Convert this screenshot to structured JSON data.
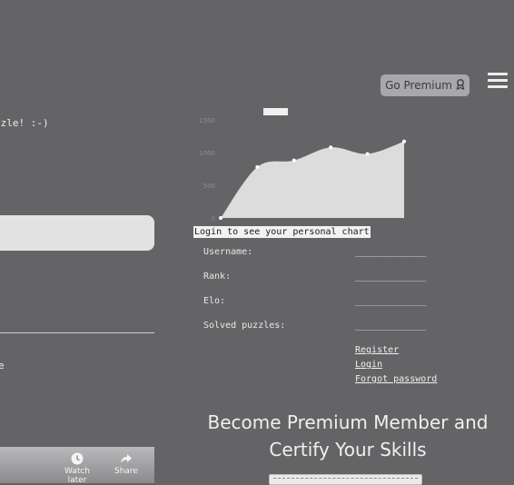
{
  "header": {
    "go_premium_label": "Go Premium"
  },
  "puzzle": {
    "message_fragment": "zzle! :-)",
    "side_fragment": "e"
  },
  "video": {
    "watch_later_label": "Watch later",
    "share_label": "Share"
  },
  "chart": {
    "login_banner": "Login to see your personal chart"
  },
  "chart_data": {
    "type": "area",
    "title": "",
    "xlabel": "",
    "ylabel": "",
    "y_ticks": [
      "1500",
      "1000",
      "500",
      "0"
    ],
    "ylim": [
      0,
      1500
    ],
    "x": [
      1,
      2,
      3,
      4,
      5,
      6
    ],
    "values": [
      0,
      780,
      880,
      1080,
      980,
      1170
    ],
    "grid": false,
    "colors": {
      "fill": "#dcdcdc",
      "points": "#ffffff"
    }
  },
  "stats": [
    {
      "label": "Username:",
      "value": "_____________"
    },
    {
      "label": "Rank:",
      "value": "_____________"
    },
    {
      "label": "Elo:",
      "value": "_____________"
    },
    {
      "label": "Solved puzzles:",
      "value": "_____________"
    }
  ],
  "account_links": {
    "register": "Register",
    "login": "Login",
    "forgot_password": "Forgot password"
  },
  "premium": {
    "heading_line1": "Become Premium Member and",
    "heading_line2": "Certify Your Skills"
  }
}
